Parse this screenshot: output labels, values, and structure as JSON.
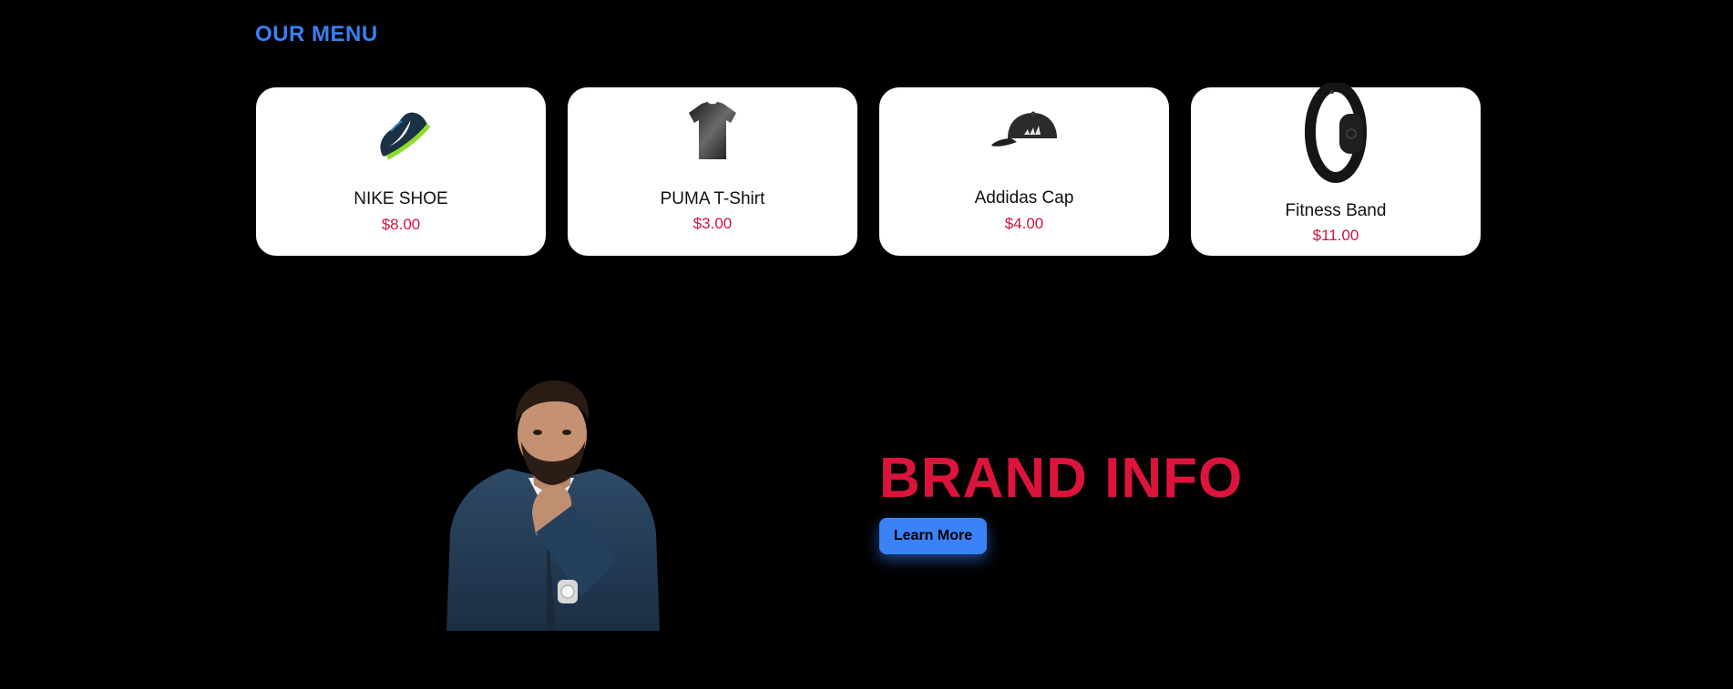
{
  "menu": {
    "heading": "OUR MENU",
    "items": [
      {
        "name": "NIKE SHOE",
        "price": "$8.00",
        "image_icon": "shoe-icon"
      },
      {
        "name": "PUMA T-Shirt",
        "price": "$3.00",
        "image_icon": "tshirt-icon"
      },
      {
        "name": "Addidas Cap",
        "price": "$4.00",
        "image_icon": "cap-icon"
      },
      {
        "name": "Fitness Band",
        "price": "$11.00",
        "image_icon": "fitness-band-icon"
      }
    ]
  },
  "brand": {
    "title": "BRAND INFO",
    "button_label": "Learn More"
  },
  "colors": {
    "background": "#000000",
    "accent_blue": "#3b82f6",
    "brand_red": "#dc143c",
    "card_bg": "#ffffff"
  }
}
